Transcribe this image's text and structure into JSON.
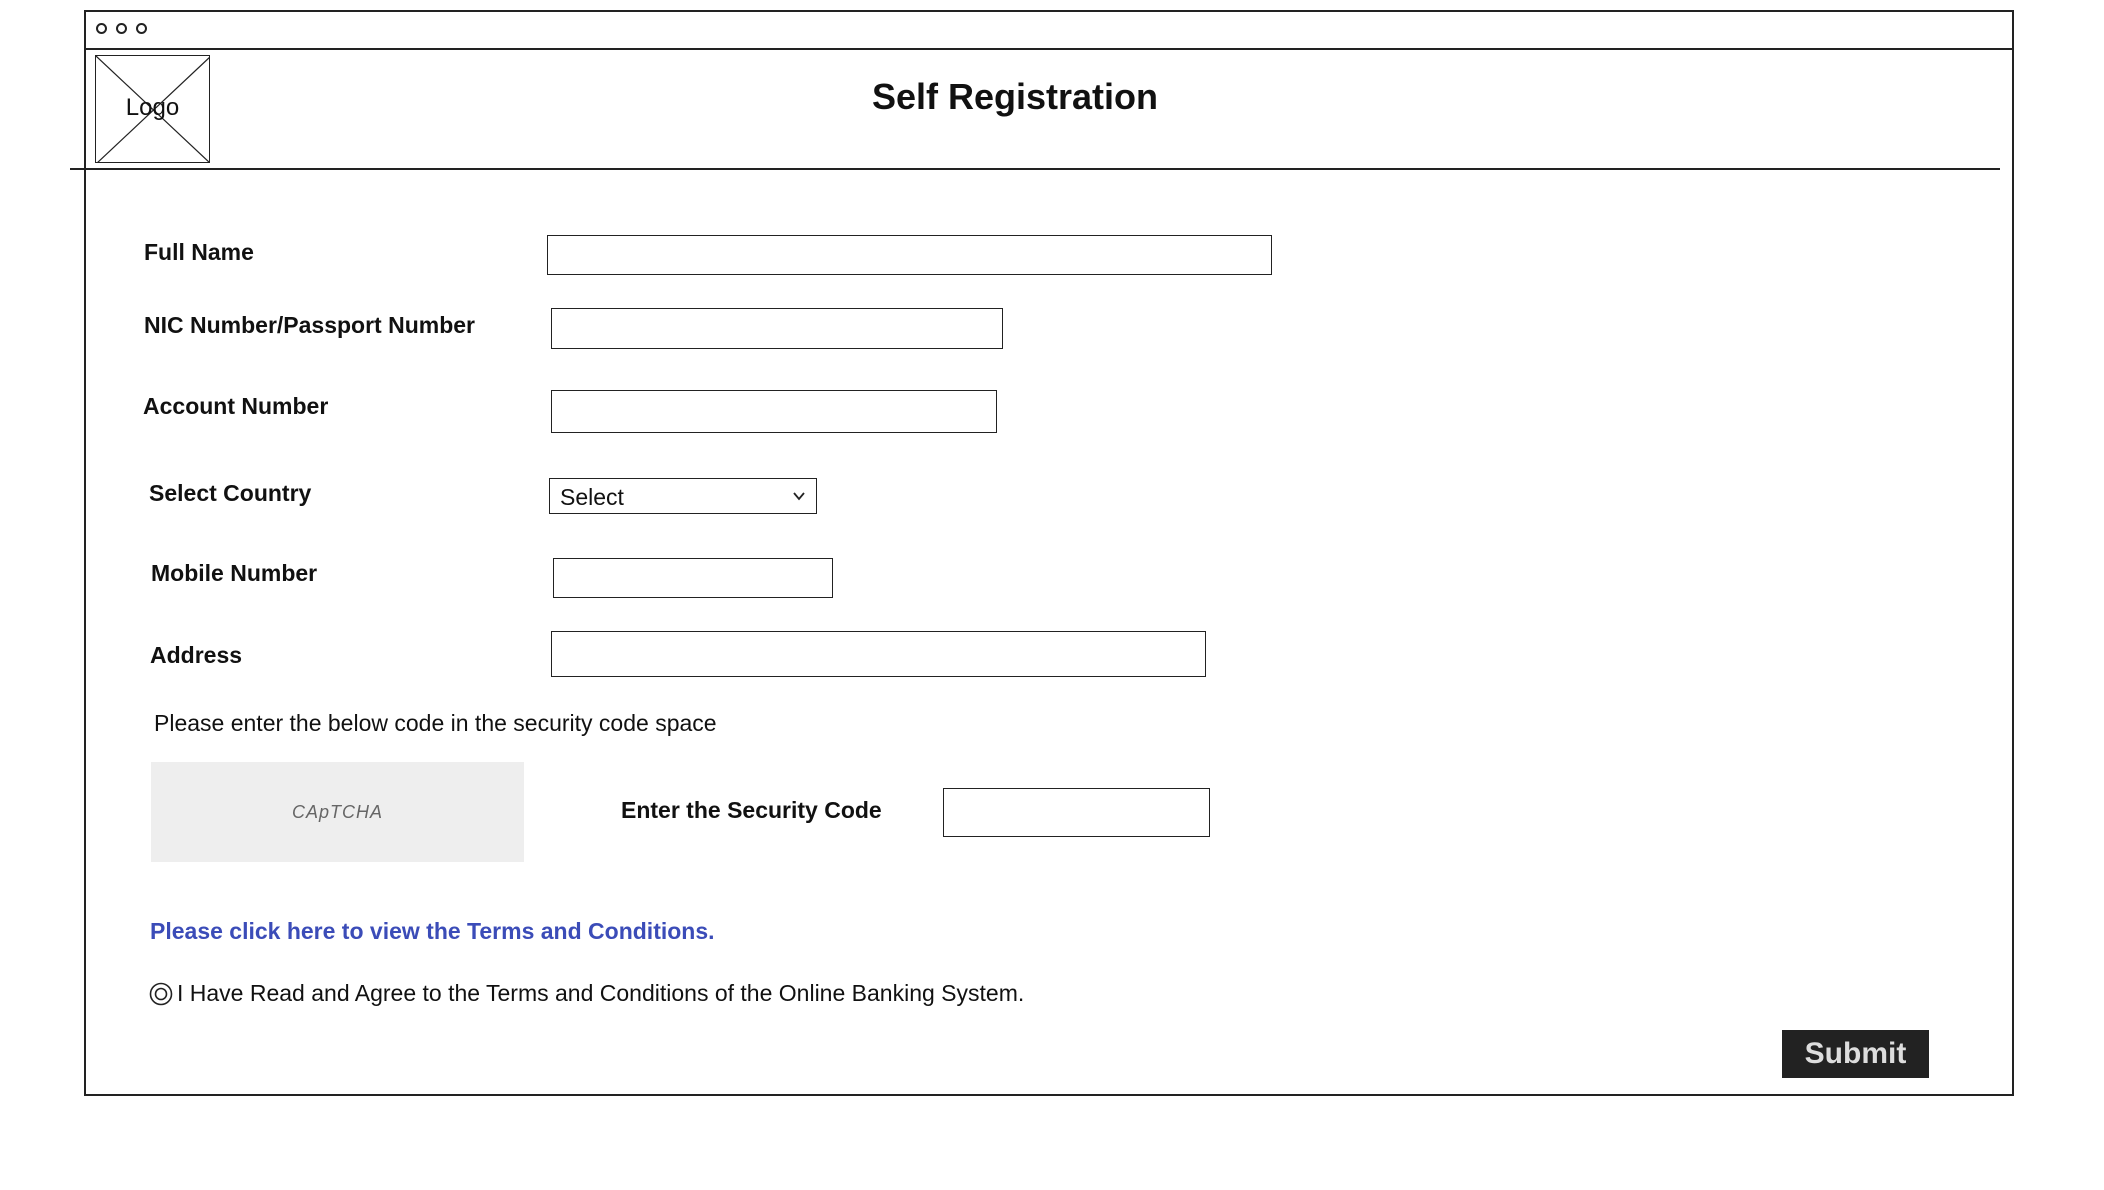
{
  "header": {
    "logo_label": "Logo",
    "title": "Self Registration"
  },
  "form": {
    "full_name_label": "Full Name",
    "full_name_value": "",
    "nic_label": "NIC Number/Passport Number",
    "nic_value": "",
    "account_label": "Account Number",
    "account_value": "",
    "country_label": "Select Country",
    "country_selected": "Select",
    "mobile_label": "Mobile Number",
    "mobile_value": "",
    "address_label": "Address",
    "address_value": ""
  },
  "security": {
    "instruction": "Please enter the below code in the security code space",
    "captcha_text": "CApTCHA",
    "code_label": "Enter the Security Code",
    "code_value": ""
  },
  "terms": {
    "link_text": "Please click here to view the Terms and Conditions.",
    "agree_text": "I Have Read and Agree to the Terms and Conditions of the Online Banking System."
  },
  "actions": {
    "submit_label": "Submit"
  }
}
